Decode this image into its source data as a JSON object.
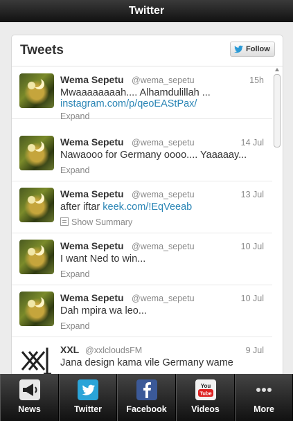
{
  "app": {
    "title": "Twitter"
  },
  "timeline": {
    "title": "Tweets",
    "follow_label": "Follow",
    "tweets": [
      {
        "name": "Wema Sepetu",
        "handle": "@wema_sepetu",
        "time": "15h",
        "text": "Mwaaaaaaaah.... Alhamdulillah ...",
        "link": "instagram.com/p/qeoEAStPax/",
        "action": "Expand"
      },
      {
        "name": "Wema Sepetu",
        "handle": "@wema_sepetu",
        "time": "14 Jul",
        "text": "Nawaooo for Germany oooo.... Yaaaaay...",
        "link": "",
        "action": "Expand"
      },
      {
        "name": "Wema Sepetu",
        "handle": "@wema_sepetu",
        "time": "13 Jul",
        "text": "after iftar ",
        "link": "keek.com/!EqVeeab",
        "action": "Show Summary"
      },
      {
        "name": "Wema Sepetu",
        "handle": "@wema_sepetu",
        "time": "10 Jul",
        "text": "I want Ned to win...",
        "link": "",
        "action": "Expand"
      },
      {
        "name": "Wema Sepetu",
        "handle": "@wema_sepetu",
        "time": "10 Jul",
        "text": "Dah mpira wa leo...",
        "link": "",
        "action": "Expand"
      },
      {
        "name": "XXL",
        "handle": "@xxlcloudsFM",
        "time": "9 Jul",
        "text": "Jana design kama vile Germany wame",
        "link": "",
        "action": ""
      }
    ]
  },
  "tabbar": {
    "tabs": [
      {
        "label": "News",
        "icon": "megaphone-icon"
      },
      {
        "label": "Twitter",
        "icon": "twitter-bird-icon"
      },
      {
        "label": "Facebook",
        "icon": "facebook-icon"
      },
      {
        "label": "Videos",
        "icon": "youtube-icon"
      },
      {
        "label": "More",
        "icon": "more-dots-icon"
      }
    ]
  }
}
